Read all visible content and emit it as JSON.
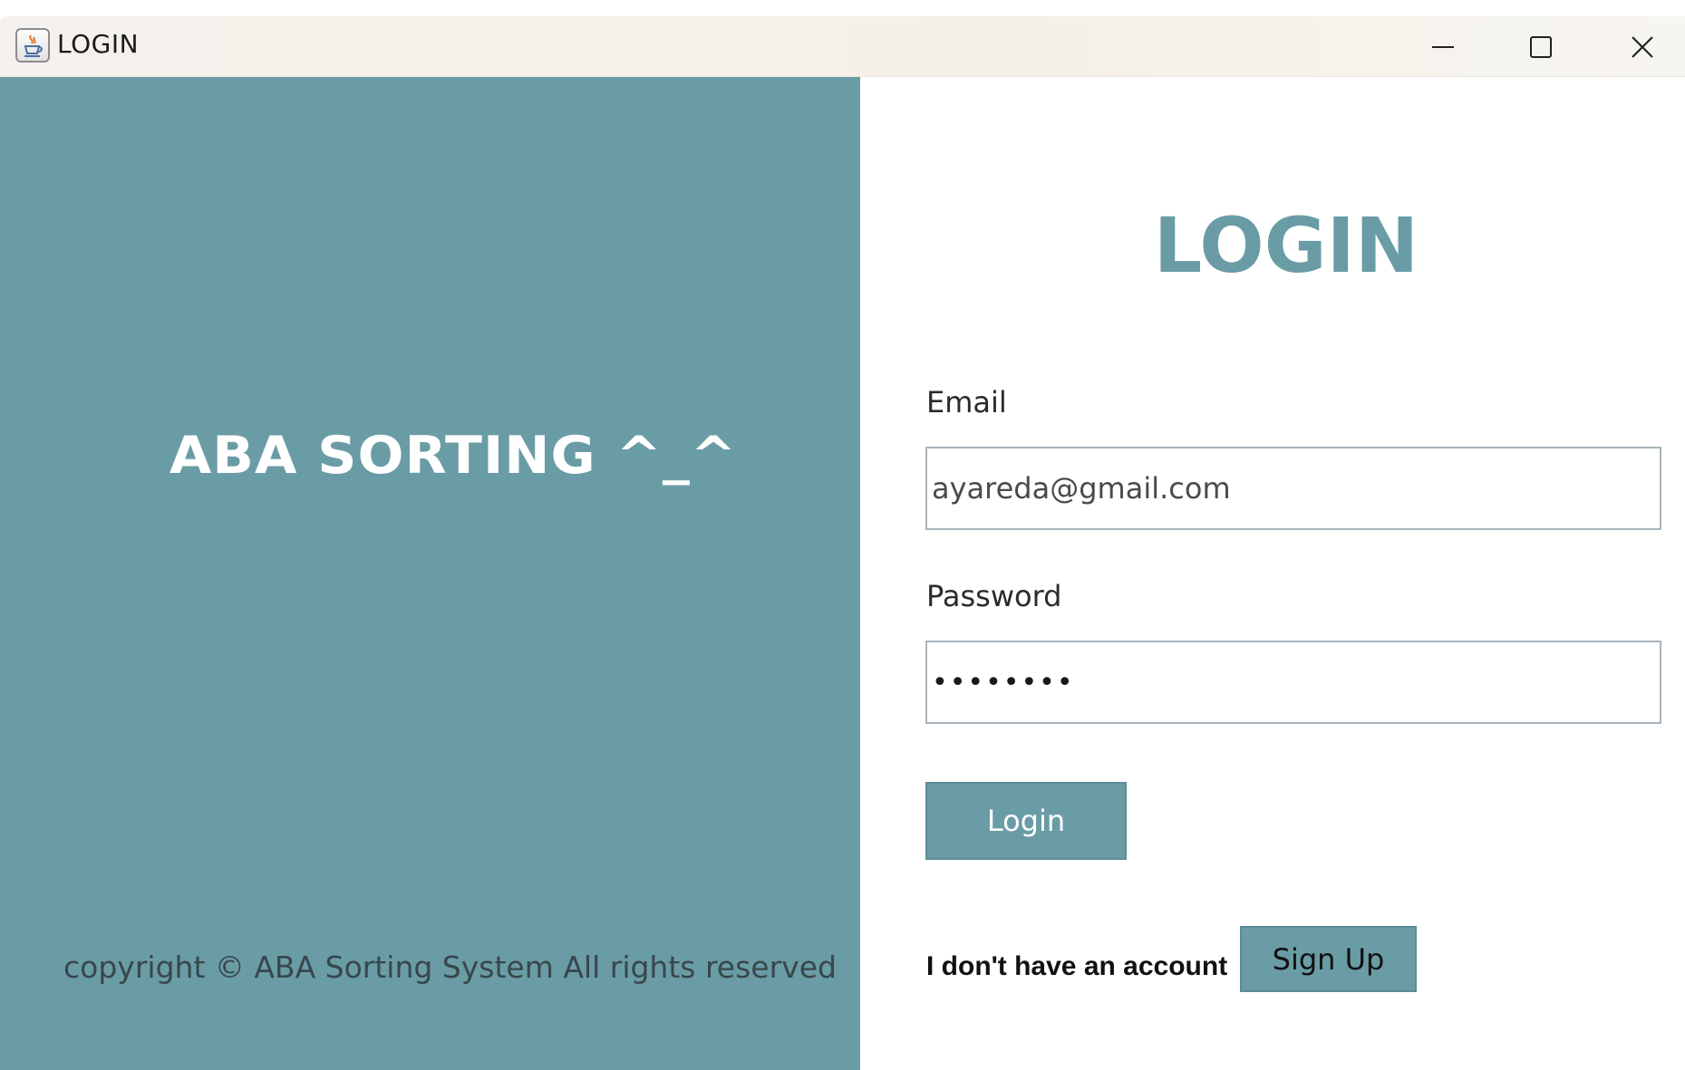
{
  "window": {
    "title": "LOGIN",
    "app_icon": "java-cup-icon",
    "controls": {
      "minimize_icon": "minimize-icon",
      "maximize_icon": "maximize-icon",
      "close_icon": "close-icon"
    }
  },
  "left_panel": {
    "brand": "ABA SORTING ^_^",
    "copyright": "copyright © ABA Sorting System All rights reserved"
  },
  "right_panel": {
    "heading": "LOGIN",
    "email_label": "Email",
    "email_value": "ayareda@gmail.com",
    "password_label": "Password",
    "password_value": "••••••••",
    "login_button": "Login",
    "no_account_text": "I don't have an account",
    "signup_button": "Sign Up"
  },
  "colors": {
    "accent": "#6a9ca6",
    "panel_text_muted": "#38474b",
    "background": "#ffffff"
  }
}
